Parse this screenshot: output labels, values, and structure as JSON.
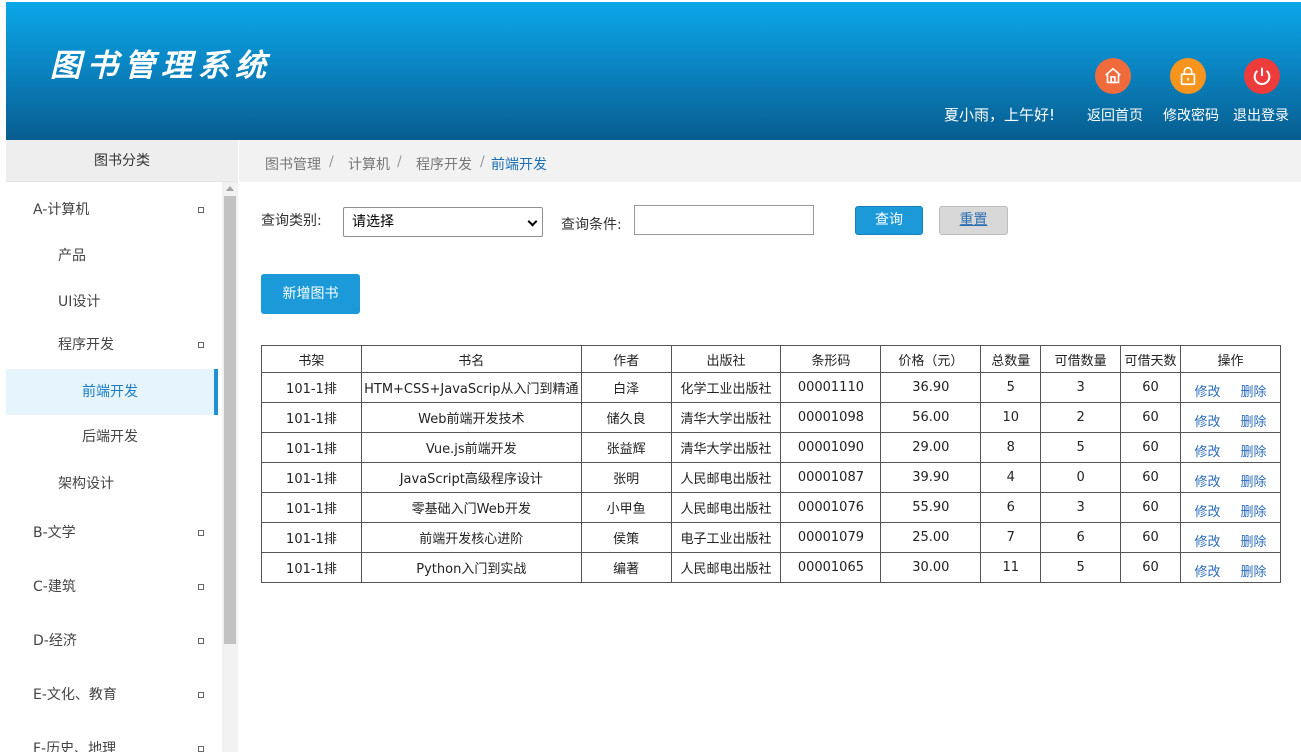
{
  "header": {
    "app_title": "图书管理系统",
    "greeting": "夏小雨，上午好!",
    "home_label": "返回首页",
    "change_password_label": "修改密码",
    "logout_label": "退出登录",
    "home_icon_color": "#f16a3c",
    "password_icon_color": "#f7941d",
    "logout_icon_color": "#ee3b3b"
  },
  "sidebar": {
    "title": "图书分类",
    "items": [
      {
        "label": "A-计算机",
        "level": 0
      },
      {
        "label": "产品",
        "level": 1
      },
      {
        "label": "UI设计",
        "level": 1
      },
      {
        "label": "程序开发",
        "level": 1
      },
      {
        "label": "前端开发",
        "level": 2,
        "active": true
      },
      {
        "label": "后端开发",
        "level": 2
      },
      {
        "label": "架构设计",
        "level": 1
      },
      {
        "label": "B-文学",
        "level": 0
      },
      {
        "label": "C-建筑",
        "level": 0
      },
      {
        "label": "D-经济",
        "level": 0
      },
      {
        "label": "E-文化、教育",
        "level": 0
      },
      {
        "label": "F-历史、地理",
        "level": 0
      }
    ]
  },
  "breadcrumb": [
    "图书管理",
    "计算机",
    "程序开发",
    "前端开发"
  ],
  "search": {
    "category_label": "查询类别:",
    "category_value": "请选择",
    "condition_label": "查询条件:",
    "condition_value": "",
    "query_label": "查询",
    "reset_label": "重置"
  },
  "add_button_label": "新增图书",
  "table": {
    "headers": [
      "书架",
      "书名",
      "作者",
      "出版社",
      "条形码",
      "价格（元）",
      "总数量",
      "可借数量",
      "可借天数",
      "操作"
    ],
    "edit_label": "修改",
    "delete_label": "删除",
    "rows": [
      [
        "101-1排",
        "HTM+CSS+JavaScrip从入门到精通",
        "白泽",
        "化学工业出版社",
        "00001110",
        "36.90",
        "5",
        "3",
        "60"
      ],
      [
        "101-1排",
        "Web前端开发技术",
        "储久良",
        "清华大学出版社",
        "00001098",
        "56.00",
        "10",
        "2",
        "60"
      ],
      [
        "101-1排",
        "Vue.js前端开发",
        "张益辉",
        "清华大学出版社",
        "00001090",
        "29.00",
        "8",
        "5",
        "60"
      ],
      [
        "101-1排",
        "JavaScript高级程序设计",
        "张明",
        "人民邮电出版社",
        "00001087",
        "39.90",
        "4",
        "0",
        "60"
      ],
      [
        "101-1排",
        "零基础入门Web开发",
        "小甲鱼",
        "人民邮电出版社",
        "00001076",
        "55.90",
        "6",
        "3",
        "60"
      ],
      [
        "101-1排",
        "前端开发核心进阶",
        "侯策",
        "电子工业出版社",
        "00001079",
        "25.00",
        "7",
        "6",
        "60"
      ],
      [
        "101-1排",
        "Python入门到实战",
        "编著",
        "人民邮电出版社",
        "00001065",
        "30.00",
        "11",
        "5",
        "60"
      ]
    ]
  }
}
